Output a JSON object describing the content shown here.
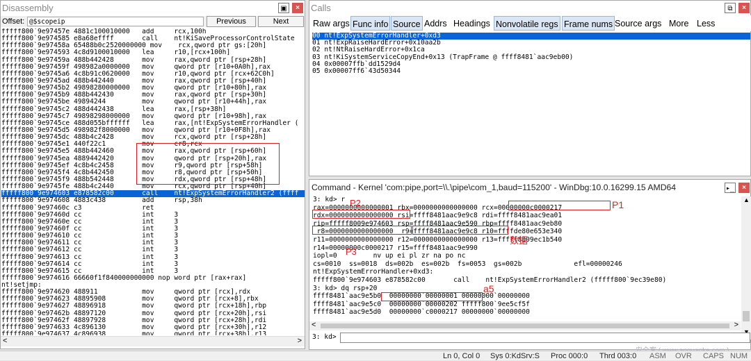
{
  "disasm": {
    "title": "Disassembly",
    "offset_label": "Offset:",
    "offset_value": "@$scopeip",
    "previous": "Previous",
    "next": "Next",
    "lines": [
      "fffff800`9e97457e 4881c100010000   add     rcx,100h",
      "fffff800`9e974585 e8a68effff       call    nt!KiSaveProcessorControlState",
      "fffff800`9e97458a 65488b0c2520000000 mov    rcx,qword ptr gs:[20h]",
      "fffff800`9e974593 4c8d9100010000   lea     r10,[rcx+100h]",
      "fffff800`9e97459a 488b442428       mov     rax,qword ptr [rsp+28h]",
      "fffff800`9e97459f 498982a0000000   mov     qword ptr [r10+0A0h],rax",
      "fffff800`9e9745a6 4c8b91c0620000   mov     r10,qword ptr [rcx+62C0h]",
      "fffff800`9e9745ad 488b442440       mov     rax,qword ptr [rsp+40h]",
      "fffff800`9e9745b2 49898280000000   mov     qword ptr [r10+80h],rax",
      "fffff800`9e9745b9 488b442430       mov     rax,qword ptr [rsp+30h]",
      "fffff800`9e9745be 49894244         mov     qword ptr [r10+44h],rax",
      "fffff800`9e9745c2 488d442438       lea     rax,[rsp+38h]",
      "fffff800`9e9745c7 49898298000000   mov     qword ptr [r10+98h],rax",
      "fffff800`9e9745ce 488d055bffffff   lea     rax,[nt!ExpSystemErrorHandler (",
      "fffff800`9e9745d5 498982f8000000   mov     qword ptr [r10+0F8h],rax",
      "fffff800`9e9745dc 488b4c2428       mov     rcx,qword ptr [rsp+28h]",
      "fffff800`9e9745e1 440f22c1         mov     cr8,rcx",
      "fffff800`9e9745e5 488b442460       mov     rax,qword ptr [rsp+60h]",
      "fffff800`9e9745ea 4889442420       mov     qword ptr [rsp+20h],rax",
      "fffff800`9e9745ef 4c8b4c2458       mov     r9,qword ptr [rsp+58h]",
      "fffff800`9e9745f4 4c8b442450       mov     r8,qword ptr [rsp+50h]",
      "fffff800`9e9745f9 488b542448       mov     rdx,qword ptr [rsp+48h]",
      "fffff800`9e9745fe 488b4c2440       mov     rcx,qword ptr [rsp+40h]",
      "fffff800`9e974603 e878582c00       call    nt!ExpSystemErrorHandler2 (ffff",
      "fffff800`9e974608 4883c438         add     rsp,38h",
      "fffff800`9e97460c c3               ret",
      "fffff800`9e97460d cc               int     3",
      "fffff800`9e97460e cc               int     3",
      "fffff800`9e97460f cc               int     3",
      "fffff800`9e974610 cc               int     3",
      "fffff800`9e974611 cc               int     3",
      "fffff800`9e974612 cc               int     3",
      "fffff800`9e974613 cc               int     3",
      "fffff800`9e974614 cc               int     3",
      "fffff800`9e974615 cc               int     3",
      "fffff800`9e974616 66660f1f840000000000 nop word ptr [rax+rax]",
      "nt!setjmp:",
      "fffff800`9e974620 488911           mov     qword ptr [rcx],rdx",
      "fffff800`9e974623 48895908         mov     qword ptr [rcx+8],rbx",
      "fffff800`9e974627 48896918         mov     qword ptr [rcx+18h],rbp",
      "fffff800`9e97462b 48897120         mov     qword ptr [rcx+20h],rsi",
      "fffff800`9e97462f 48897928         mov     qword ptr [rcx+28h],rdi",
      "fffff800`9e974633 4c896130         mov     qword ptr [rcx+30h],r12",
      "fffff800`9e974637 4c896938         mov     qword ptr [rcx+38h],r13",
      "fffff800`9e97463b 4c897140         mov     qword ptr [rcx+40h],r14"
    ]
  },
  "calls": {
    "title": "Calls",
    "tabs": [
      "Raw args",
      "Func info",
      "Source",
      "Addrs",
      "Headings",
      "Nonvolatile regs",
      "Frame nums",
      "Source args",
      "More",
      "Less"
    ],
    "frames": [
      "00 nt!ExpSystemErrorHandler+0xd3",
      "01 nt!ExpRaiseHardError+0x10aa2b",
      "02 nt!NtRaiseHardError+0x1ca",
      "03 nt!KiSystemServiceCopyEnd+0x13 (TrapFrame @ ffff8481`aac9eb00)",
      "04 0x00007ffb`dd1529d4",
      "05 0x00007ff6`43d50344"
    ]
  },
  "command": {
    "title": "Command - Kernel 'com:pipe,port=\\\\.\\pipe\\com_1,baud=115200' - WinDbg:10.0.16299.15 AMD64",
    "lines": [
      "3: kd> r",
      "rax=0000000000000001 rbx=0000000000000000 rcx=00000000c0000217",
      "rdx=0000000000000000 rsi=ffff8481aac9e9c8 rdi=ffff8481aac9ea01",
      "rip=fffff8009e974603 rsp=ffff8481aac9e590 rbp=ffff8481aac9eb80",
      " r8=0000000000000000  r9=ffff8481aac9e9c8 r10=ffffde80e653e340",
      "r11=0000000000000000 r12=0000000000000000 r13=fffff8009ec1b540",
      "r14=00000000c0000217 r15=ffff8481aac9e990",
      "iopl=0         nv up ei pl zr na po nc",
      "cs=0010  ss=0018  ds=002b  es=002b  fs=0053  gs=002b             efl=00000246",
      "nt!ExpSystemErrorHandler+0xd3:",
      "fffff800`9e974603 e878582c00       call    nt!ExpSystemErrorHandler2 (fffff800`9ec39e80)",
      "3: kd> dq rsp+20",
      "ffff8481`aac9e5b0  00000000`00000001 00000000`00000000",
      "ffff8481`aac9e5c0  00000000`00000202 fffff800`9ee5cf5f",
      "ffff8481`aac9e5d0  00000000`c0000217 00000000`00000000"
    ],
    "prompt": "3: kd>",
    "input": ""
  },
  "annotations": {
    "p1": "P1",
    "p2": "P2",
    "p3": "P3",
    "a5": "a5",
    "data": "数据"
  },
  "status": {
    "lncol": "Ln 0, Col 0",
    "sys": "Sys 0:KdSrv:S",
    "proc": "Proc 000:0",
    "thrd": "Thrd 003:0",
    "asm": "ASM",
    "ovr": "OVR",
    "caps": "CAPS",
    "num": "NUM"
  },
  "watermark": "安全客 ( www.anquanke.com )",
  "colors": {
    "highlight": "#0a64d8",
    "annotation": "#e02020",
    "close": "#d9534f"
  }
}
